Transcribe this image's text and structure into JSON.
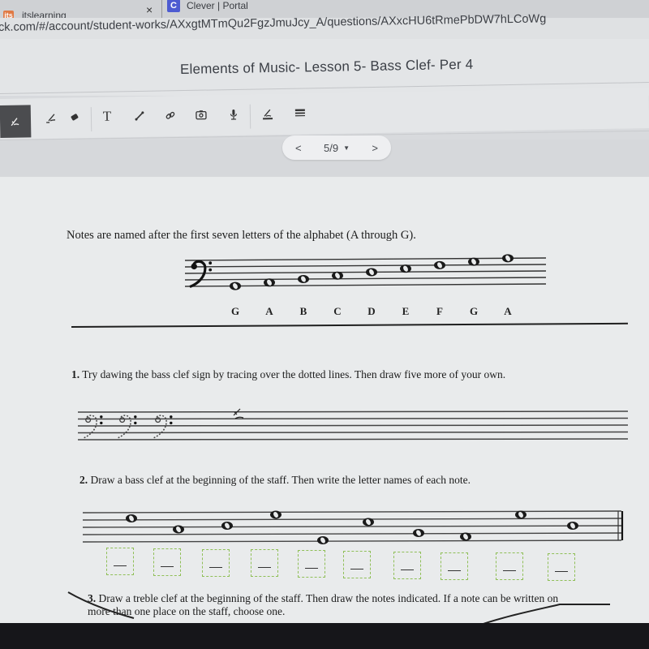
{
  "browser": {
    "tabs": [
      {
        "label": "itslearning",
        "favicon": "itslearning-logo"
      },
      {
        "label": "Clever | Portal",
        "favicon": "clever-logo"
      }
    ],
    "close_glyph": "×",
    "url": "ck.com/#/account/student-works/AXxgtMTmQu2FgzJmuJcy_A/questions/AXxcHU6tRmePbDW7hLCoWg"
  },
  "header": {
    "title": "Elements of Music- Lesson 5- Bass Clef- Per 4"
  },
  "toolbar": {
    "tools": [
      {
        "name": "pen-tool",
        "icon": "pen-icon",
        "active": true
      },
      {
        "name": "highlighter-tool",
        "icon": "highlighter-icon"
      },
      {
        "name": "eraser-tool",
        "icon": "eraser-icon"
      },
      {
        "name": "text-tool",
        "icon": "text-icon",
        "glyph": "T"
      },
      {
        "name": "line-tool",
        "icon": "line-icon"
      },
      {
        "name": "link-tool",
        "icon": "link-icon"
      },
      {
        "name": "photo-tool",
        "icon": "camera-icon"
      },
      {
        "name": "voice-tool",
        "icon": "microphone-icon"
      },
      {
        "name": "pen-color-tool",
        "icon": "pen-color-icon"
      },
      {
        "name": "line-width-tool",
        "icon": "line-width-icon"
      }
    ]
  },
  "pager": {
    "prev": "<",
    "current": "5/9",
    "caret": "▼",
    "next": ">"
  },
  "worksheet": {
    "intro": "Notes are named after the first seven letters of the alphabet (A through G).",
    "example_notes": [
      "G",
      "A",
      "B",
      "C",
      "D",
      "E",
      "F",
      "G",
      "A"
    ],
    "q1": {
      "number": "1.",
      "text": "Try dawing the bass clef sign by tracing over the dotted lines. Then draw five more of your own."
    },
    "q2": {
      "number": "2.",
      "text": "Draw a bass clef at the beginning of the staff.  Then write the letter names of each note.",
      "answers": [
        "",
        "",
        "",
        "",
        "",
        "",
        "",
        "",
        "",
        ""
      ]
    },
    "q3": {
      "number": "3.",
      "text_line1": "Draw a treble clef at the beginning of the staff.  Then draw the notes indicated. If a note can be written on",
      "text_line2": "more than one place on the staff, choose one."
    }
  },
  "colors": {
    "answer_box_border": "#8fbf57",
    "active_tool_bg": "#4b4c4f"
  }
}
